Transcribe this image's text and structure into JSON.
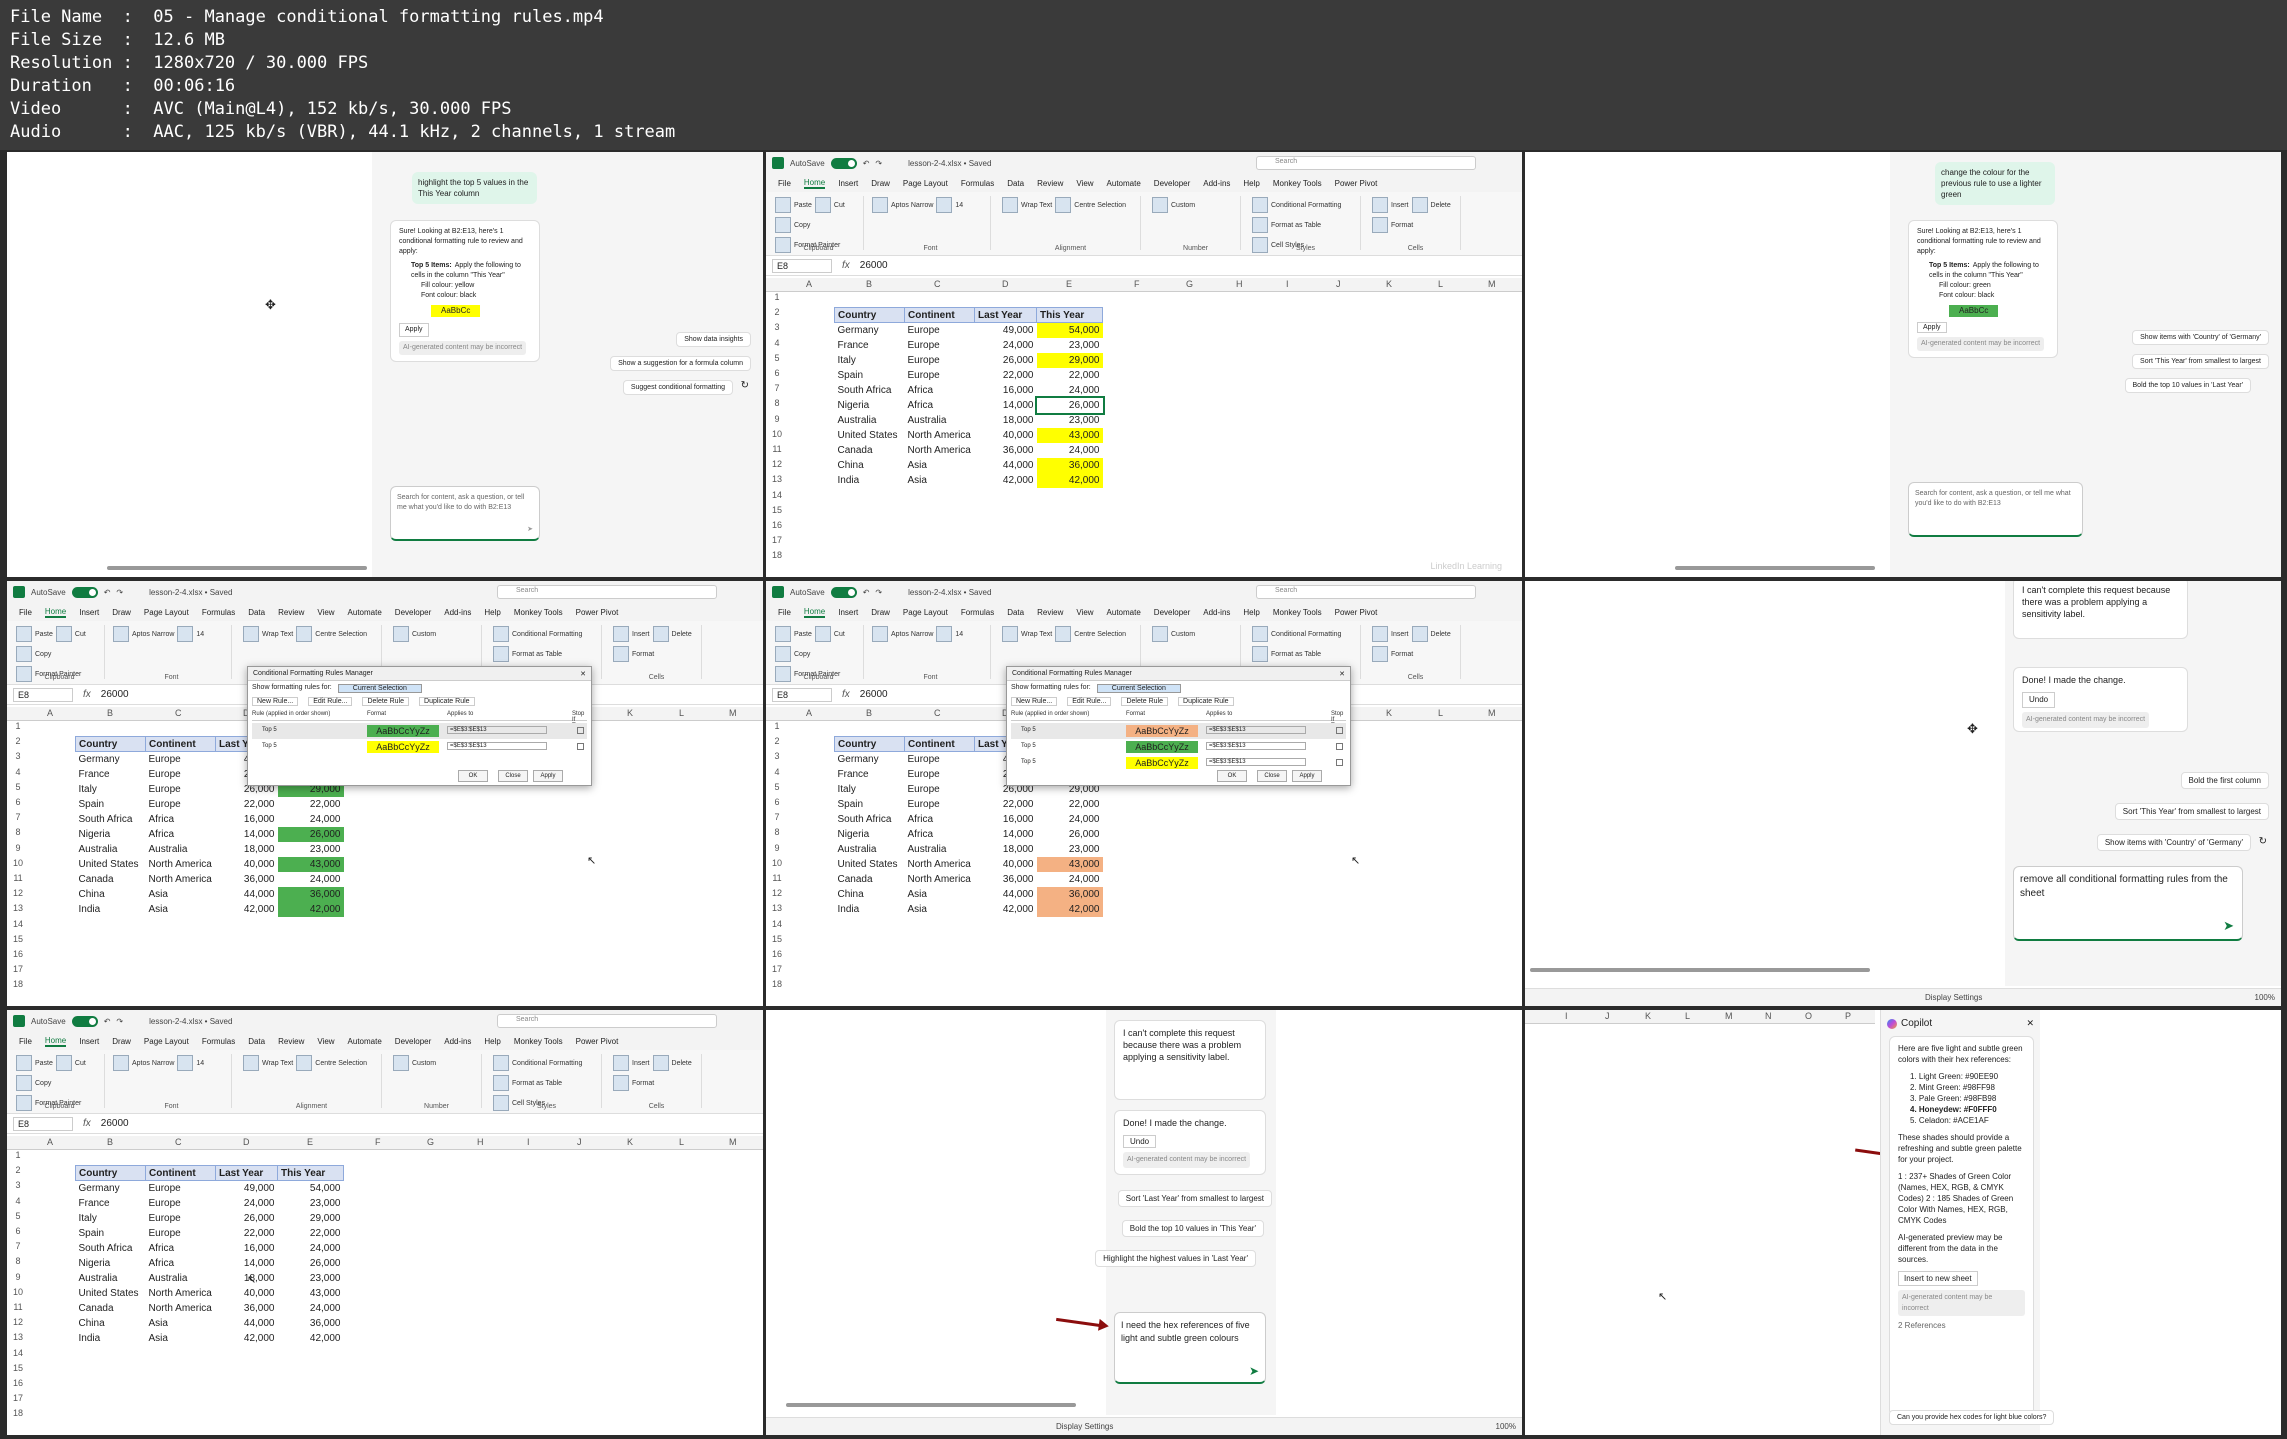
{
  "header": {
    "lines": [
      "File Name  :  05 - Manage conditional formatting rules.mp4",
      "File Size  :  12.6 MB",
      "Resolution :  1280x720 / 30.000 FPS",
      "Duration   :  00:06:16",
      "Video      :  AVC (Main@L4), 152 kb/s, 30.000 FPS",
      "Audio      :  AAC, 125 kb/s (VBR), 44.1 kHz, 2 channels, 1 stream"
    ]
  },
  "excel": {
    "autosave": "AutoSave",
    "file": "lesson-2-4.xlsx • Saved",
    "search": "Search",
    "menu": [
      "File",
      "Home",
      "Insert",
      "Draw",
      "Page Layout",
      "Formulas",
      "Data",
      "Review",
      "View",
      "Automate",
      "Developer",
      "Add-ins",
      "Help",
      "Monkey Tools",
      "Power Pivot"
    ],
    "ribbon": {
      "paste": "Paste",
      "cut": "Cut",
      "copy": "Copy",
      "format_painter": "Format Painter",
      "clipboard": "Clipboard",
      "font_name": "Aptos Narrow",
      "font_size": "14",
      "font": "Font",
      "wrap": "Wrap Text",
      "merge": "Centre Selection",
      "alignment": "Alignment",
      "number_format": "Custom",
      "number": "Number",
      "cond": "Conditional Formatting",
      "format_table": "Format as Table",
      "cell_styles": "Cell Styles",
      "styles": "Styles",
      "insert": "Insert",
      "delete": "Delete",
      "format": "Format",
      "cells": "Cells"
    },
    "namebox_e8": "E8",
    "namebox_e8b": "E8",
    "formula_value": "26000",
    "columns": [
      "A",
      "B",
      "C",
      "D",
      "E",
      "F",
      "G",
      "H",
      "I",
      "J",
      "K",
      "L",
      "M"
    ],
    "headers": [
      "Country",
      "Continent",
      "Last Year",
      "This Year"
    ],
    "rows": [
      [
        "Germany",
        "Europe",
        "49,000",
        "54,000"
      ],
      [
        "France",
        "Europe",
        "24,000",
        "23,000"
      ],
      [
        "Italy",
        "Europe",
        "26,000",
        "29,000"
      ],
      [
        "Spain",
        "Europe",
        "22,000",
        "22,000"
      ],
      [
        "South Africa",
        "Africa",
        "16,000",
        "24,000"
      ],
      [
        "Nigeria",
        "Africa",
        "14,000",
        "26,000"
      ],
      [
        "Australia",
        "Australia",
        "18,000",
        "23,000"
      ],
      [
        "United States",
        "North America",
        "40,000",
        "43,000"
      ],
      [
        "Canada",
        "North America",
        "36,000",
        "24,000"
      ],
      [
        "China",
        "Asia",
        "44,000",
        "36,000"
      ],
      [
        "India",
        "Asia",
        "42,000",
        "42,000"
      ]
    ],
    "highlight_rows_yellow": [
      0,
      2,
      7,
      9,
      10
    ],
    "highlight_rows_green": [
      0,
      2,
      5,
      7,
      9,
      10
    ],
    "highlight_rows_orange": [
      0,
      7,
      9,
      10
    ],
    "colors": {
      "yellow": "#ffff00",
      "green": "#4caf50",
      "orange": "#f4b183",
      "header": "#d9e1f2",
      "excel_green": "#107c41"
    }
  },
  "dialog": {
    "title": "Conditional Formatting Rules Manager",
    "show_for": "Show formatting rules for:",
    "show_value": "Current Selection",
    "new_rule": "New Rule...",
    "edit_rule": "Edit Rule...",
    "delete_rule": "Delete Rule",
    "duplicate_rule": "Duplicate Rule",
    "col_rule": "Rule (applied in order shown)",
    "col_format": "Format",
    "col_applies": "Applies to",
    "col_stop": "Stop If True",
    "rule_name": "Top 5",
    "preview": "AaBbCcYyZz",
    "applies": "=$E$3:$E$13",
    "ok": "OK",
    "close": "Close",
    "apply": "Apply"
  },
  "copilot": {
    "p1_user": "highlight the top 5 values in the This Year column",
    "p1_resp_intro": "Sure! Looking at B2:E13, here's 1 conditional formatting rule to review and apply:",
    "p1_rule_title": "Top 5 Items:",
    "p1_rule_text": "Apply the following to cells in the column \"This Year\"",
    "p1_fill": "Fill colour: yellow",
    "p1_font": "Font colour: black",
    "swatch": "AaBbCc",
    "apply": "Apply",
    "ai_note": "AI-generated content may be incorrect",
    "p1_chips": [
      "Show data insights",
      "Show a suggestion for a formula column",
      "Suggest conditional formatting"
    ],
    "input_placeholder": "Search for content, ask a question, or tell me what you'd like to do with B2:E13",
    "p3_user": "change the colour for the previous rule to use a lighter green",
    "p3_fill": "Fill colour: green",
    "p3_chips": [
      "Show items with 'Country' of 'Germany'",
      "Sort 'This Year' from smallest to largest",
      "Bold the top 10 values in 'Last Year'"
    ],
    "p6_sens": "I can't complete this request because there was a problem applying a sensitivity label.",
    "p6_done": "Done! I made the change.",
    "undo": "Undo",
    "p6_chips": [
      "Bold the first column",
      "Sort 'This Year' from smallest to largest",
      "Show items with 'Country' of 'Germany'"
    ],
    "p6_input": "remove all conditional formatting rules from the sheet",
    "p8_chips": [
      "Sort 'Last Year' from smallest to largest",
      "Bold the top 10 values in 'This Year'",
      "Highlight the highest values in 'Last Year'"
    ],
    "p8_input": "I need the hex references of five light and subtle green colours",
    "status_display": "Display Settings",
    "zoom": "100%",
    "p9_title": "Copilot",
    "p9_intro": "Here are five light and subtle green colors with their hex references:",
    "p9_list": [
      "1. Light Green: #90EE90",
      "2. Mint Green: #98FF98",
      "3. Pale Green: #98FB98",
      "4. Honeydew: #F0FFF0",
      "5. Celadon: #ACE1AF"
    ],
    "p9_para": "These shades should provide a refreshing and subtle green palette for your project.",
    "p9_refs": "1 : 237+ Shades of Green Color (Names, HEX, RGB, & CMYK Codes) 2 : 185 Shades of Green Color With Names, HEX, RGB, CMYK Codes",
    "p9_warn": "AI-generated preview may be different from the data in the sources.",
    "p9_insert": "Insert to new sheet",
    "p9_refcount": "2 References",
    "p9_footer": "Can you provide hex codes for light blue colors?",
    "p9_cols": [
      "I",
      "J",
      "K",
      "L",
      "M",
      "N",
      "O",
      "P"
    ],
    "watermark": "LinkedIn Learning"
  }
}
